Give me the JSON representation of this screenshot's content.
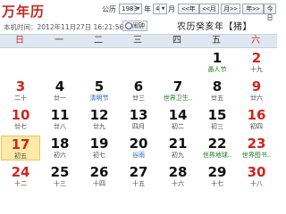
{
  "header": {
    "title": "万年历",
    "gregorian_label": "公历",
    "year_value": "1983",
    "year_label": "年",
    "month_value": "4",
    "month_label": "月",
    "nav": [
      "<<年",
      "<<月",
      "月>>",
      "年>>",
      "今日"
    ],
    "now_text": "本机时间：2012年11月27日 16:21:56",
    "alarm_label": "闹钟",
    "lunar_year": "农历癸亥年【猪】"
  },
  "weekdays": [
    "日",
    "一",
    "二",
    "三",
    "四",
    "五",
    "六"
  ],
  "weeks": [
    [
      {
        "day": "",
        "sub": ""
      },
      {
        "day": "",
        "sub": ""
      },
      {
        "day": "",
        "sub": ""
      },
      {
        "day": "",
        "sub": ""
      },
      {
        "day": "",
        "sub": ""
      },
      {
        "day": "1",
        "sub": "愚人节",
        "kind": "festival"
      },
      {
        "day": "2",
        "sub": "十九"
      }
    ],
    [
      {
        "day": "3",
        "sub": "二十"
      },
      {
        "day": "4",
        "sub": "廿一"
      },
      {
        "day": "5",
        "sub": "清明节",
        "kind": "special"
      },
      {
        "day": "6",
        "sub": "廿三"
      },
      {
        "day": "7",
        "sub": "世界卫生..",
        "kind": "festival"
      },
      {
        "day": "8",
        "sub": "廿五"
      },
      {
        "day": "9",
        "sub": "廿六"
      }
    ],
    [
      {
        "day": "10",
        "sub": "廿七"
      },
      {
        "day": "11",
        "sub": "廿八"
      },
      {
        "day": "12",
        "sub": "廿九"
      },
      {
        "day": "13",
        "sub": "四月"
      },
      {
        "day": "14",
        "sub": "初二"
      },
      {
        "day": "15",
        "sub": "初三"
      },
      {
        "day": "16",
        "sub": "初四"
      }
    ],
    [
      {
        "day": "17",
        "sub": "初五",
        "today": true
      },
      {
        "day": "18",
        "sub": "初六"
      },
      {
        "day": "19",
        "sub": "初七"
      },
      {
        "day": "20",
        "sub": "谷雨",
        "kind": "special"
      },
      {
        "day": "21",
        "sub": "初九"
      },
      {
        "day": "22",
        "sub": "世界地球..",
        "kind": "festival"
      },
      {
        "day": "23",
        "sub": "世界图书..",
        "kind": "festival"
      }
    ],
    [
      {
        "day": "24",
        "sub": "十二"
      },
      {
        "day": "25",
        "sub": "十三"
      },
      {
        "day": "26",
        "sub": "十四"
      },
      {
        "day": "27",
        "sub": "十五"
      },
      {
        "day": "28",
        "sub": "十六"
      },
      {
        "day": "29",
        "sub": "十七"
      },
      {
        "day": "30",
        "sub": "十八"
      }
    ]
  ],
  "colors": {
    "title": "#c8281e",
    "weekend": "#d0261c",
    "festival": "#1d7a1d",
    "solar_term": "#1f5fc2",
    "today_bg": "#fde9a8",
    "header_row": "#dfe8f1"
  }
}
